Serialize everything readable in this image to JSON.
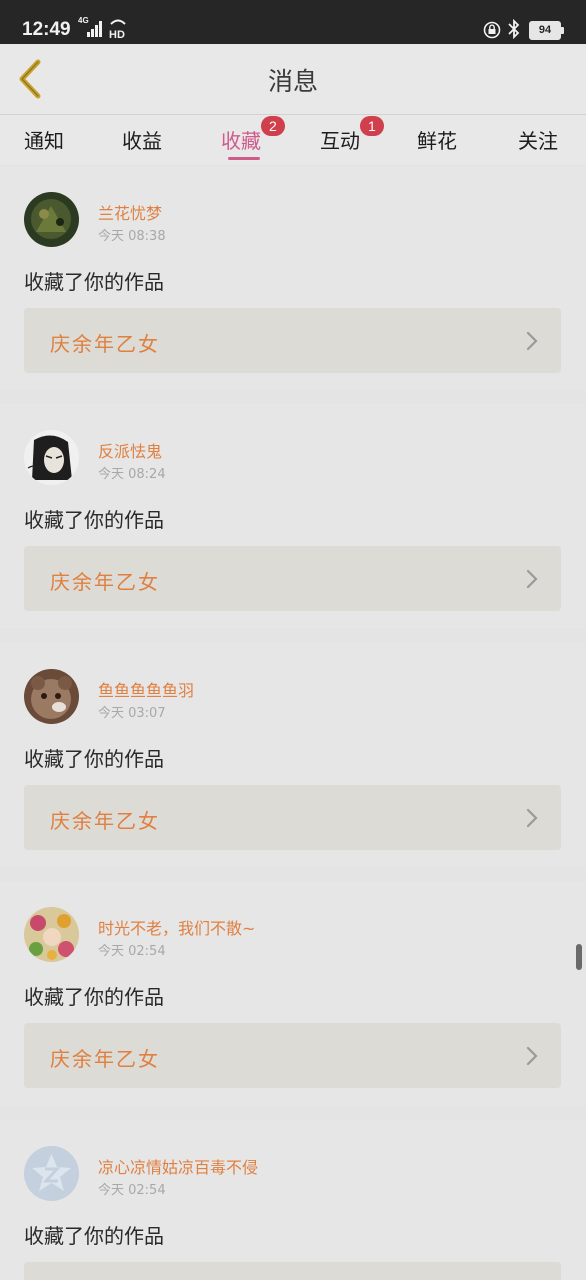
{
  "status_bar": {
    "time": "12:49",
    "network": "4G",
    "hd_label": "HD",
    "battery": "94"
  },
  "header": {
    "title": "消息"
  },
  "tabs": [
    {
      "label": "通知",
      "badge": null,
      "active": false
    },
    {
      "label": "收益",
      "badge": null,
      "active": false
    },
    {
      "label": "收藏",
      "badge": "2",
      "active": true
    },
    {
      "label": "互动",
      "badge": "1",
      "active": false
    },
    {
      "label": "鲜花",
      "badge": null,
      "active": false
    },
    {
      "label": "关注",
      "badge": null,
      "active": false
    }
  ],
  "messages": [
    {
      "username": "兰花忧梦",
      "time": "今天 08:38",
      "action": "收藏了你的作品",
      "work": "庆余年乙女",
      "avatar": "avatar-dark-green"
    },
    {
      "username": "反派怯鬼",
      "time": "今天 08:24",
      "action": "收藏了你的作品",
      "work": "庆余年乙女",
      "avatar": "avatar-sketch-portrait"
    },
    {
      "username": "鱼鱼鱼鱼鱼羽",
      "time": "今天 03:07",
      "action": "收藏了你的作品",
      "work": "庆余年乙女",
      "avatar": "avatar-bear"
    },
    {
      "username": "时光不老，我们不散~",
      "time": "今天 02:54",
      "action": "收藏了你的作品",
      "work": "庆余年乙女",
      "avatar": "avatar-floral"
    },
    {
      "username": "凉心凉情姑凉百毒不侵",
      "time": "今天 02:54",
      "action": "收藏了你的作品",
      "work": "",
      "avatar": "avatar-default-star"
    }
  ],
  "colors": {
    "accent": "#cf5b8d",
    "badge": "#cf3f4c",
    "username": "#e08040",
    "work_title": "#e08040",
    "back_icon": "#c9a227"
  }
}
